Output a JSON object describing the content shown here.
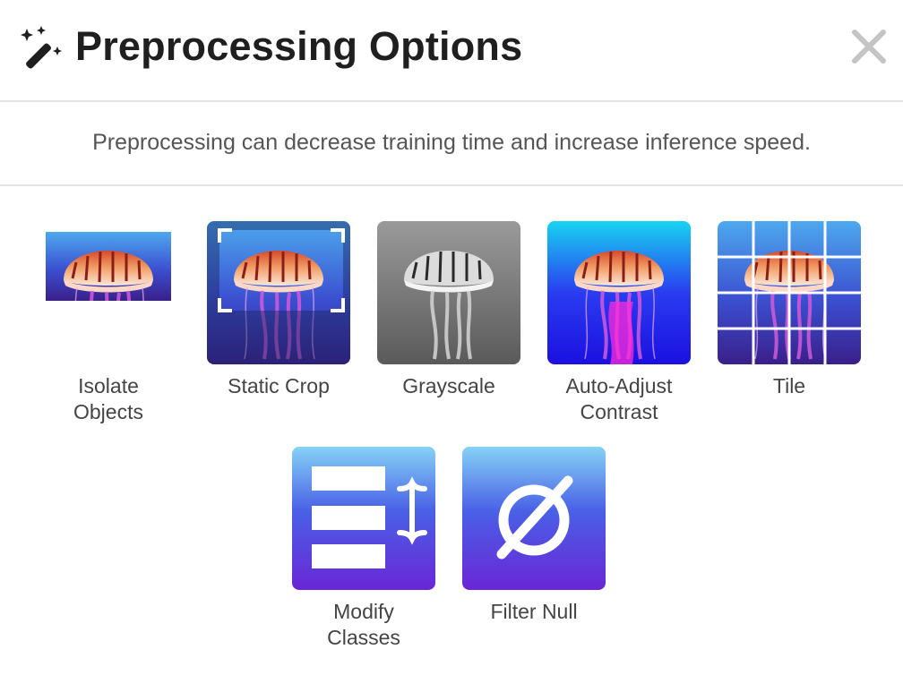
{
  "dialog": {
    "title": "Preprocessing Options",
    "description": "Preprocessing can decrease training time and increase inference speed.",
    "header_icon": "magic-wand-icon",
    "close_icon": "close-icon"
  },
  "options": [
    {
      "label_line1": "Isolate",
      "label_line2": "Objects"
    },
    {
      "label_line1": "Static Crop",
      "label_line2": ""
    },
    {
      "label_line1": "Grayscale",
      "label_line2": ""
    },
    {
      "label_line1": "Auto-Adjust",
      "label_line2": "Contrast"
    },
    {
      "label_line1": "Tile",
      "label_line2": ""
    },
    {
      "label_line1": "Modify",
      "label_line2": "Classes"
    },
    {
      "label_line1": "Filter Null",
      "label_line2": ""
    }
  ],
  "colors": {
    "accent_top": "#7fd4f5",
    "accent_bottom": "#6a2bd9",
    "divider": "#e3e3e3"
  }
}
